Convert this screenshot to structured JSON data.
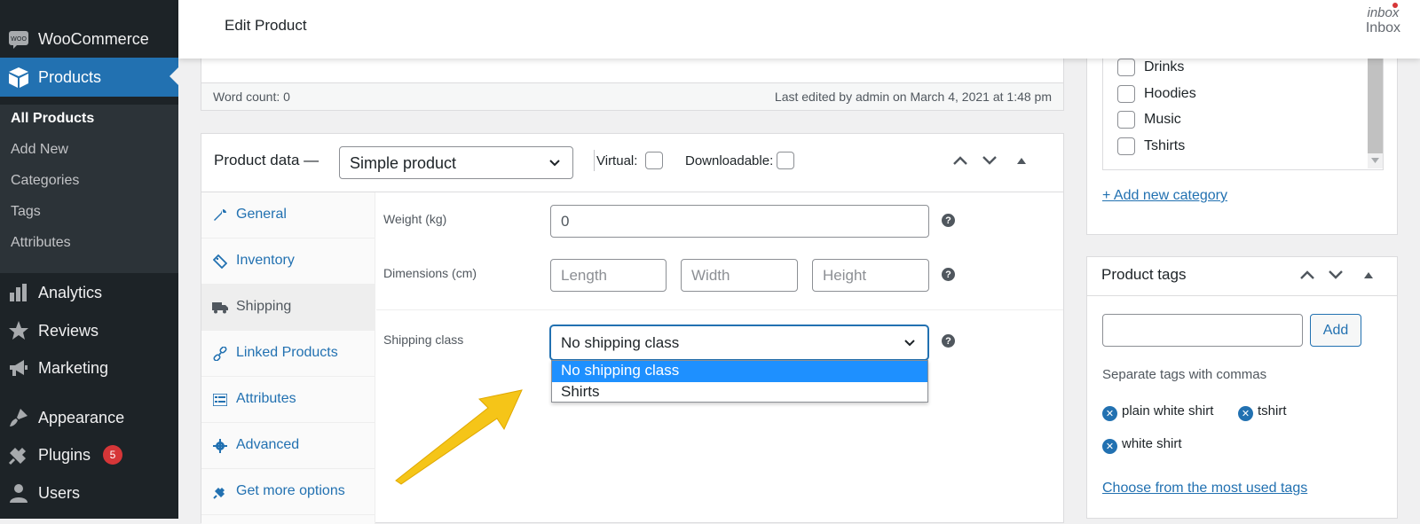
{
  "sidebar": {
    "woocommerce": "WooCommerce",
    "products": "Products",
    "submenu": [
      "All Products",
      "Add New",
      "Categories",
      "Tags",
      "Attributes"
    ],
    "analytics": "Analytics",
    "reviews": "Reviews",
    "marketing": "Marketing",
    "appearance": "Appearance",
    "plugins": "Plugins",
    "plugins_badge": "5",
    "users": "Users"
  },
  "topbar": {
    "title": "Edit Product",
    "inbox_icon_text": "inbox",
    "inbox_label": "Inbox"
  },
  "editor": {
    "word_count": "Word count: 0",
    "last_edited": "Last edited by admin on March 4, 2021 at 1:48 pm"
  },
  "product_data": {
    "title": "Product data —",
    "type_selected": "Simple product",
    "virtual_label": "Virtual:",
    "downloadable_label": "Downloadable:",
    "tabs": [
      "General",
      "Inventory",
      "Shipping",
      "Linked Products",
      "Attributes",
      "Advanced",
      "Get more options"
    ],
    "weight_label": "Weight (kg)",
    "weight_value": "0",
    "dimensions_label": "Dimensions (cm)",
    "length_ph": "Length",
    "width_ph": "Width",
    "height_ph": "Height",
    "shipping_class_label": "Shipping class",
    "shipping_class_selected": "No shipping class",
    "shipping_class_options": [
      "No shipping class",
      "Shirts"
    ]
  },
  "categories": {
    "items": [
      "Drinks",
      "Hoodies",
      "Music",
      "Tshirts"
    ],
    "add_new": "+ Add new category"
  },
  "tags": {
    "title": "Product tags",
    "add_button": "Add",
    "hint": "Separate tags with commas",
    "items": [
      "plain white shirt",
      "tshirt",
      "white shirt"
    ],
    "most_used": "Choose from the most used tags"
  },
  "colors": {
    "admin_dark": "#1d2327",
    "accent": "#2271b1",
    "highlight": "#1e90ff",
    "arrow": "#f5c518"
  }
}
